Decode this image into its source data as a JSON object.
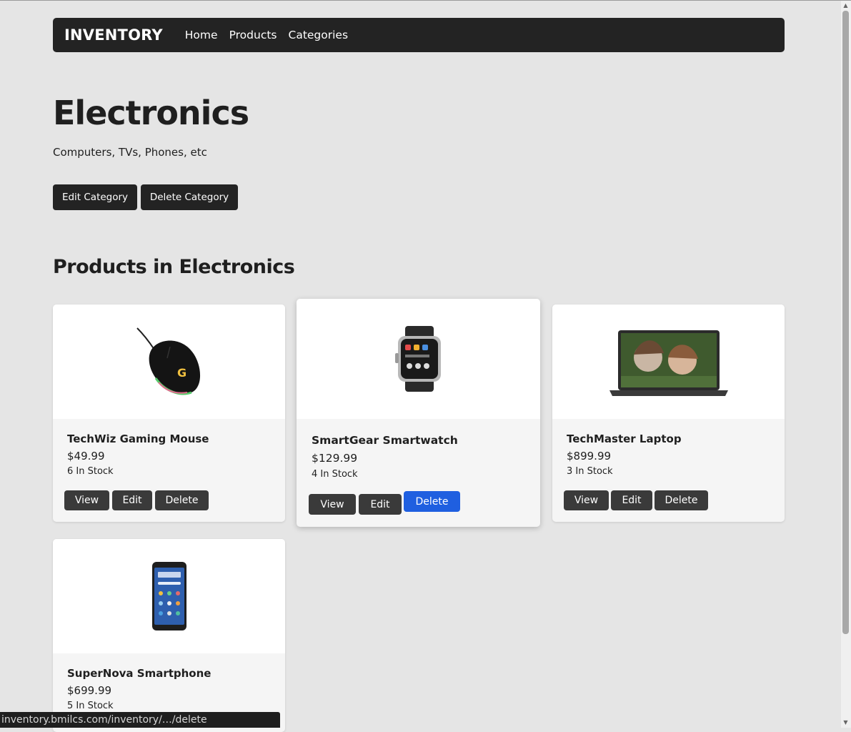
{
  "nav": {
    "brand": "INVENTORY",
    "links": [
      "Home",
      "Products",
      "Categories"
    ]
  },
  "category": {
    "title": "Electronics",
    "description": "Computers, TVs, Phones, etc",
    "edit_label": "Edit Category",
    "delete_label": "Delete Category"
  },
  "section_title": "Products in Electronics",
  "products": [
    {
      "name": "TechWiz Gaming Mouse",
      "price": "$49.99",
      "stock": "6 In Stock",
      "image": "gaming-mouse-image"
    },
    {
      "name": "SmartGear Smartwatch",
      "price": "$129.99",
      "stock": "4 In Stock",
      "image": "smartwatch-image"
    },
    {
      "name": "TechMaster Laptop",
      "price": "$899.99",
      "stock": "3 In Stock",
      "image": "laptop-image"
    },
    {
      "name": "SuperNova Smartphone",
      "price": "$699.99",
      "stock": "5 In Stock",
      "image": "smartphone-image"
    }
  ],
  "card_buttons": {
    "view": "View",
    "edit": "Edit",
    "delete": "Delete"
  },
  "status_url": "inventory.bmilcs.com/inventory/…/delete",
  "colors": {
    "navbar": "#232323",
    "background": "#e5e5e5",
    "accent": "#1f5fe0",
    "button": "#3a3a3a"
  }
}
